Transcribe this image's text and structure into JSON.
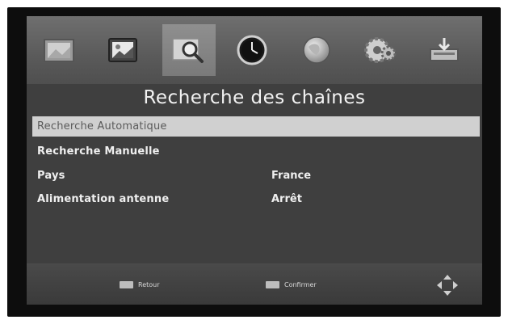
{
  "menu": {
    "tabs": [
      {
        "icon": "picture-frame-icon"
      },
      {
        "icon": "image-icon"
      },
      {
        "icon": "search-magnifier-icon",
        "active": true
      },
      {
        "icon": "clock-icon"
      },
      {
        "icon": "globe-icon"
      },
      {
        "icon": "gears-icon"
      },
      {
        "icon": "usb-storage-icon"
      }
    ],
    "title": "Recherche des chaînes"
  },
  "items": [
    {
      "label": "Recherche Automatique",
      "value": "",
      "selected": true
    },
    {
      "label": "Recherche Manuelle",
      "value": ""
    },
    {
      "label": "Pays",
      "value": "France"
    },
    {
      "label": "Alimentation antenne",
      "value": "Arrêt"
    }
  ],
  "footer": {
    "back_key_label": "",
    "back_label": "Retour",
    "ok_key_label": "",
    "confirm_label": "Confirmer",
    "nav_icon": "navigation-arrows-icon"
  },
  "colors": {
    "highlight": "#d0d0d0",
    "background": "#3f3f3f",
    "text": "#efefef"
  }
}
